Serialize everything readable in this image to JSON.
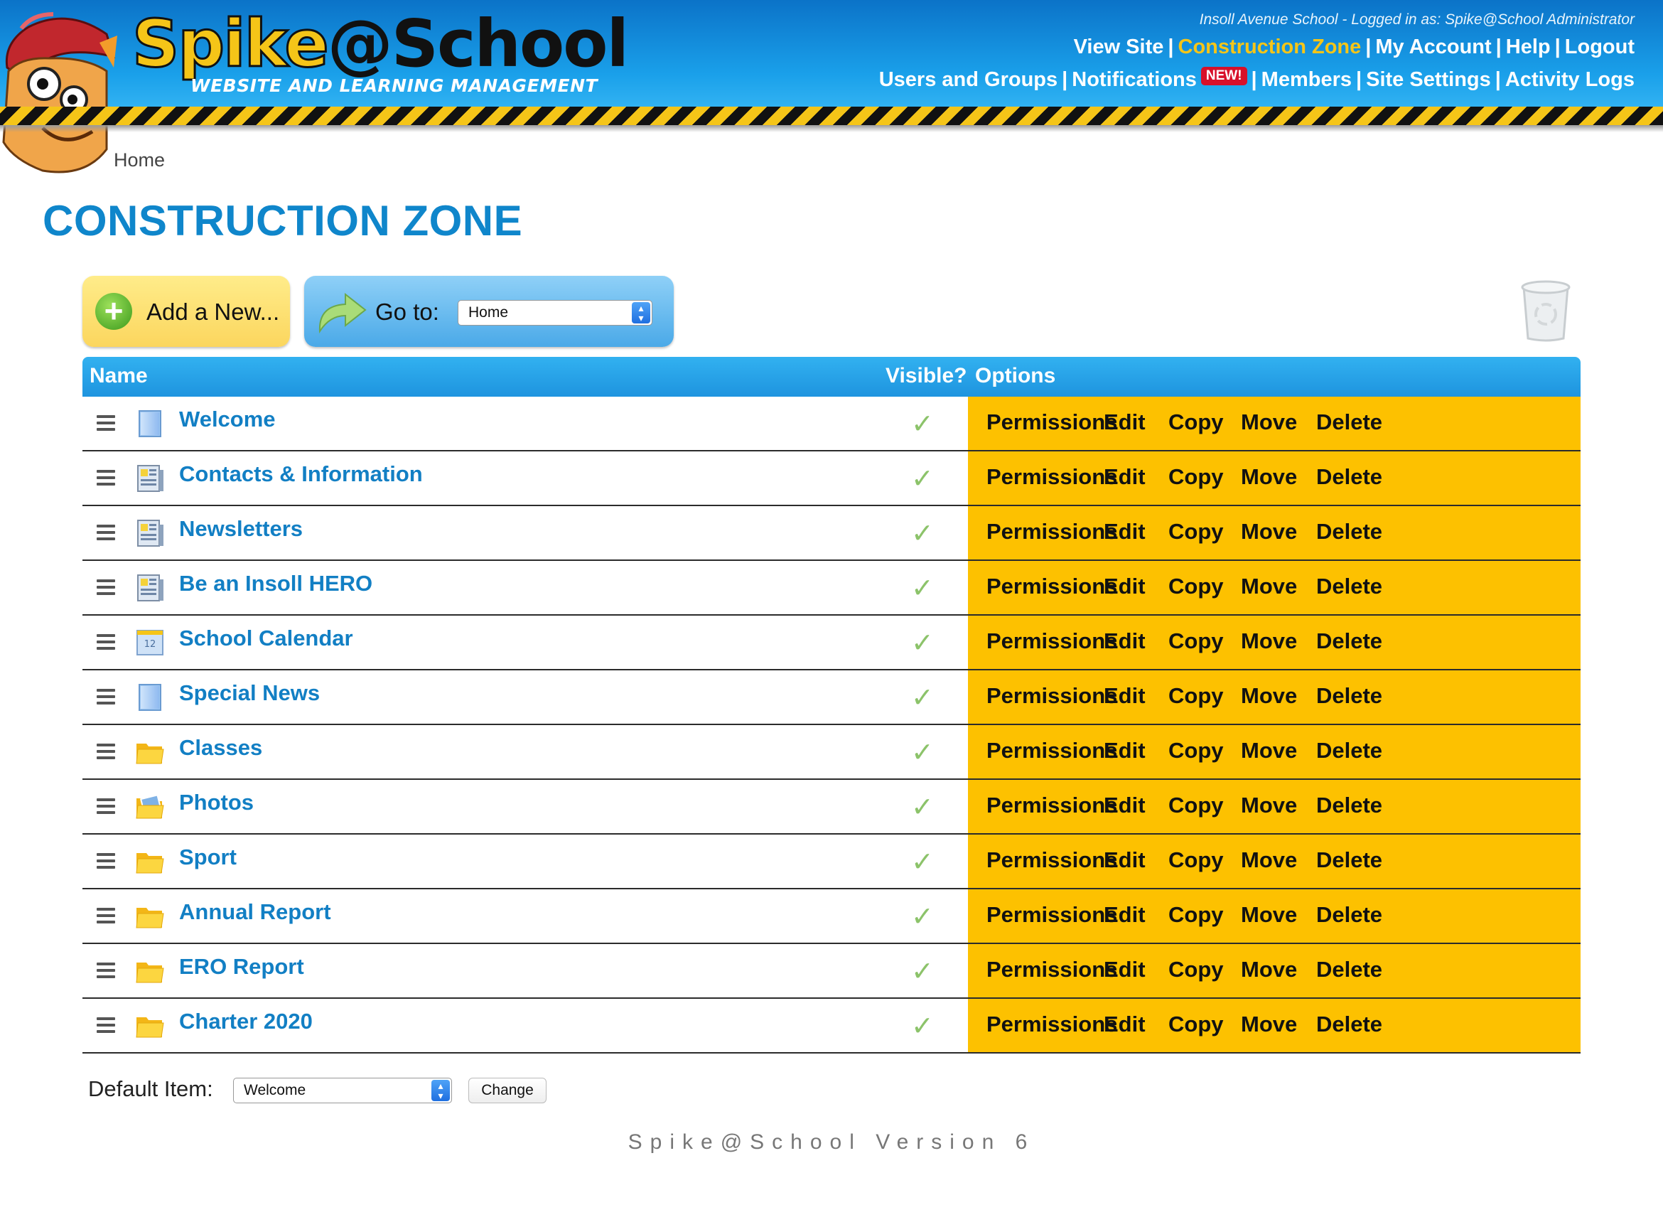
{
  "header": {
    "logo_main": "Spike@School",
    "logo_sub": "WEBSITE AND LEARNING MANAGEMENT",
    "login_info": "Insoll Avenue School - Logged in as: Spike@School Administrator",
    "nav_primary": [
      "View Site",
      "Construction Zone",
      "My Account",
      "Help",
      "Logout"
    ],
    "nav_secondary": [
      "Users and Groups",
      "Notifications",
      "Members",
      "Site Settings",
      "Activity Logs"
    ],
    "notifications_badge": "NEW!",
    "active_nav": "Construction Zone",
    "colors": {
      "accent_yellow": "#f5c518",
      "header_blue": "#1aa0ea",
      "options_bg": "#fdc100",
      "link_blue": "#127fc4",
      "badge_red": "#d8102a"
    }
  },
  "breadcrumb": "Home",
  "page_title": "CONSTRUCTION ZONE",
  "toolbar": {
    "add_new_label": "Add a New...",
    "goto_label": "Go to:",
    "goto_value": "Home"
  },
  "table": {
    "headers": {
      "name": "Name",
      "visible": "Visible?",
      "options": "Options"
    },
    "option_labels": [
      "Permissions",
      "Edit",
      "Copy",
      "Move",
      "Delete"
    ],
    "rows": [
      {
        "name": "Welcome",
        "icon": "page-icon",
        "visible": "✓"
      },
      {
        "name": "Contacts & Information",
        "icon": "newsletter-page-icon",
        "visible": "✓"
      },
      {
        "name": "Newsletters",
        "icon": "newsletter-page-icon",
        "visible": "✓"
      },
      {
        "name": "Be an Insoll HERO",
        "icon": "newsletter-page-icon",
        "visible": "✓"
      },
      {
        "name": "School Calendar",
        "icon": "calendar-icon",
        "visible": "✓"
      },
      {
        "name": "Special News",
        "icon": "page-icon",
        "visible": "✓"
      },
      {
        "name": "Classes",
        "icon": "folder-icon",
        "visible": "✓"
      },
      {
        "name": "Photos",
        "icon": "photo-folder-icon",
        "visible": "✓"
      },
      {
        "name": "Sport",
        "icon": "folder-icon",
        "visible": "✓"
      },
      {
        "name": "Annual Report",
        "icon": "folder-icon",
        "visible": "✓"
      },
      {
        "name": "ERO Report",
        "icon": "folder-icon",
        "visible": "✓"
      },
      {
        "name": "Charter 2020",
        "icon": "folder-icon",
        "visible": "✓"
      }
    ]
  },
  "default_item": {
    "label": "Default Item:",
    "value": "Welcome",
    "change_label": "Change"
  },
  "footer": "Spike@School Version 6"
}
